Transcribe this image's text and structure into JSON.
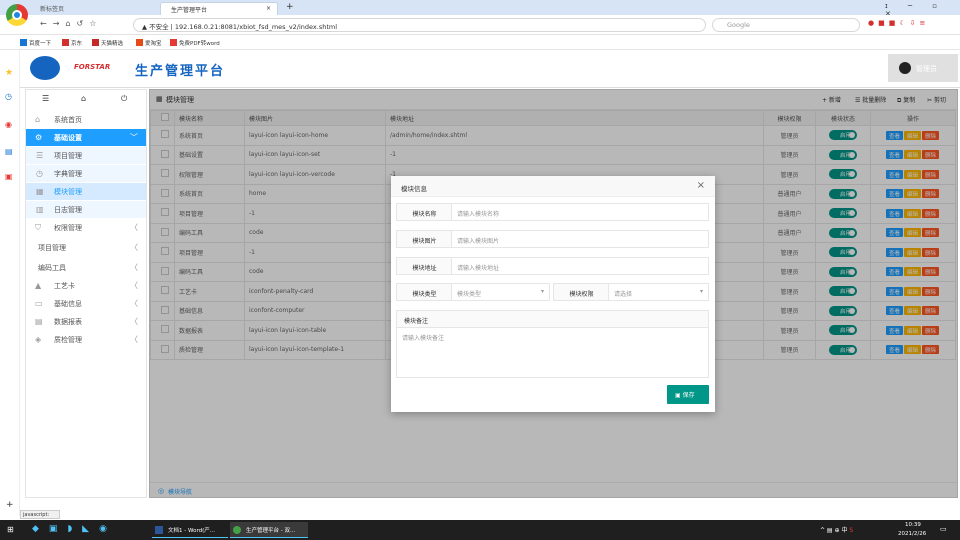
{
  "browser": {
    "tabs": [
      "新标签页",
      "生产管理平台"
    ],
    "new_tab": "+",
    "security": "不安全",
    "url": "192.168.0.21:8081/xbiot_fsd_mes_v2/index.shtml",
    "search_engine": "Google",
    "bookmarks": [
      "百度一下",
      "京东",
      "天猫精选",
      "爱淘宝",
      "免费PDF转word"
    ],
    "status_url": "javascript:"
  },
  "app": {
    "brand": "FORSTAR",
    "title": "生产管理平台",
    "user": "管理员"
  },
  "sidebar": {
    "items": [
      {
        "label": "系统首页",
        "icon": "home-icon",
        "active": false,
        "sub": false
      },
      {
        "label": "基础设置",
        "icon": "gear-icon",
        "active": true,
        "sub": false,
        "arrow": "﹀"
      },
      {
        "label": "项目管理",
        "icon": "list-icon",
        "active": false,
        "sub": true
      },
      {
        "label": "字典管理",
        "icon": "clock-icon",
        "active": false,
        "sub": true
      },
      {
        "label": "模块管理",
        "icon": "module-icon",
        "active": false,
        "sub": true,
        "selected": true
      },
      {
        "label": "日志管理",
        "icon": "grid-icon",
        "active": false,
        "sub": true
      },
      {
        "label": "权限管理",
        "icon": "shield-icon",
        "active": false,
        "sub": false,
        "arrow": "〈"
      },
      {
        "label": "项目管理",
        "icon": "",
        "active": false,
        "sub": false,
        "arrow": "〈"
      },
      {
        "label": "编码工具",
        "icon": "",
        "active": false,
        "sub": false,
        "arrow": "〈"
      },
      {
        "label": "工艺卡",
        "icon": "pin-icon",
        "active": false,
        "sub": false,
        "arrow": "〈"
      },
      {
        "label": "基础信息",
        "icon": "monitor-icon",
        "active": false,
        "sub": false,
        "arrow": "〈"
      },
      {
        "label": "数据报表",
        "icon": "chart-icon",
        "active": false,
        "sub": false,
        "arrow": "〈"
      },
      {
        "label": "质检管理",
        "icon": "stack-icon",
        "active": false,
        "sub": false,
        "arrow": "〈"
      }
    ]
  },
  "content": {
    "title": "模块管理",
    "toolbar": [
      "+ 新增",
      "批量删除",
      "复制",
      "剪切"
    ],
    "footer": "模块导航",
    "columns": [
      "模块名称",
      "模块图片",
      "模块地址",
      "模块权限",
      "模块状态",
      "操作"
    ],
    "switch_label": "启用",
    "ops": [
      "查看",
      "编辑",
      "删除"
    ],
    "rows": [
      [
        "系统首页",
        "layui-icon layui-icon-home",
        "/admin/home/index.shtml",
        "管理员"
      ],
      [
        "基础设置",
        "layui-icon layui-icon-set",
        "-1",
        "管理员"
      ],
      [
        "权限管理",
        "layui-icon layui-icon-vercode",
        "-1",
        "管理员"
      ],
      [
        "系统首页",
        "home",
        "",
        "普通用户"
      ],
      [
        "项目管理",
        "-1",
        "",
        "普通用户"
      ],
      [
        "编码工具",
        "code",
        "",
        "普通用户"
      ],
      [
        "项目管理",
        "-1",
        "",
        "管理员"
      ],
      [
        "编码工具",
        "code",
        "",
        "管理员"
      ],
      [
        "工艺卡",
        "iconfont-penalty-card",
        "",
        "管理员"
      ],
      [
        "基础信息",
        "iconfont-computer",
        "",
        "管理员"
      ],
      [
        "数据报表",
        "layui-icon layui-icon-table",
        "",
        "管理员"
      ],
      [
        "质检管理",
        "layui-icon layui-icon-template-1",
        "",
        "管理员"
      ]
    ]
  },
  "modal": {
    "title": "模块信息",
    "close": "×",
    "fields": [
      {
        "label": "模块名称",
        "placeholder": "请输入模块名称"
      },
      {
        "label": "模块图片",
        "placeholder": "请输入模块图片"
      },
      {
        "label": "模块地址",
        "placeholder": "请输入模块地址"
      }
    ],
    "type_label": "模块类型",
    "type_value": "模块类型",
    "perm_label": "模块权限",
    "perm_value": "请选择",
    "remark_label": "模块备注",
    "remark_placeholder": "请输入模块备注",
    "save": "保存"
  },
  "taskbar": {
    "apps": [
      "文档1 - Word(产...",
      "生产管理平台 - 双..."
    ],
    "tray": "中",
    "time": "10:39",
    "date": "2021/2/26"
  },
  "colors": {
    "accent": "#009688",
    "blue": "#1e9fff",
    "orange": "#ffb800",
    "red": "#ff5722",
    "brand": "#1565c0"
  }
}
